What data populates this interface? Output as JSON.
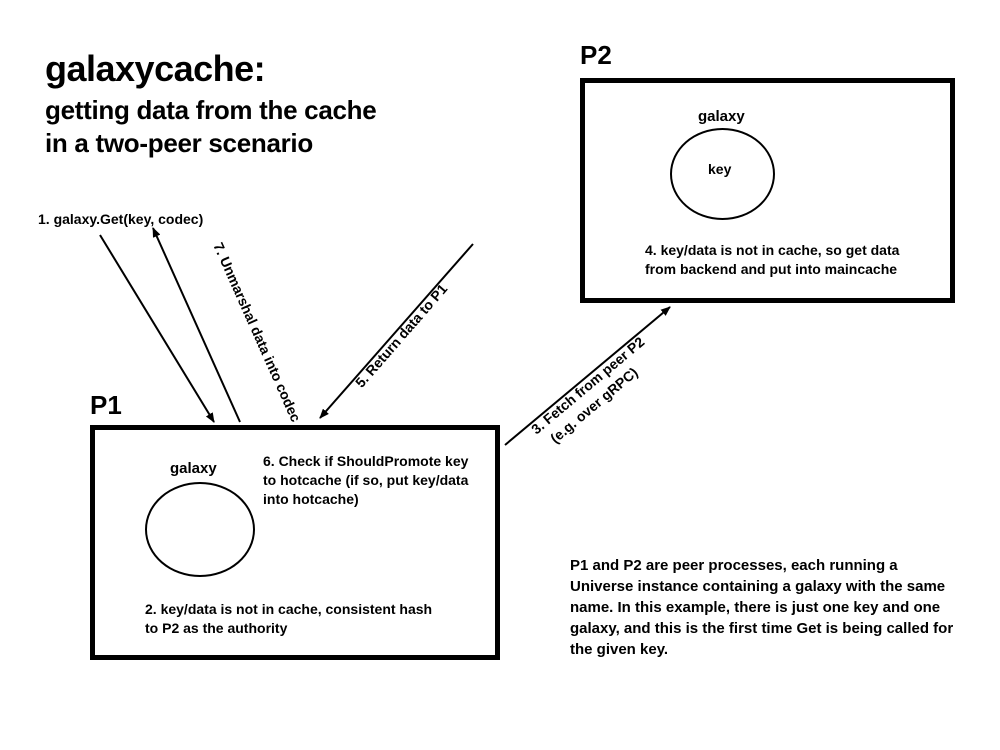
{
  "title": "galaxycache:",
  "subtitle_line1": "getting data from the cache",
  "subtitle_line2": "in a two-peer scenario",
  "p1": {
    "label": "P1",
    "galaxy_label": "galaxy",
    "internal_text": "6. Check if ShouldPromote key to hotcache (if so, put key/data into hotcache)",
    "bottom_text": "2. key/data is not in cache, consistent hash to P2 as the authority"
  },
  "p2": {
    "label": "P2",
    "galaxy_label": "galaxy",
    "key_label": "key",
    "bottom_text": "4. key/data is not in cache, so get data from backend and put into maincache"
  },
  "steps": {
    "s1": "1. galaxy.Get(key, codec)",
    "s3_line1": "3. Fetch from peer P2",
    "s3_line2": "(e.g. over gRPC)",
    "s5": "5. Return data to P1",
    "s7": "7. Unmarshal data into codec"
  },
  "description": "P1 and P2 are peer processes, each running a Universe instance containing a galaxy with the same name. In this example, there is just one key and one galaxy, and this is the first time Get is being called for the given key."
}
